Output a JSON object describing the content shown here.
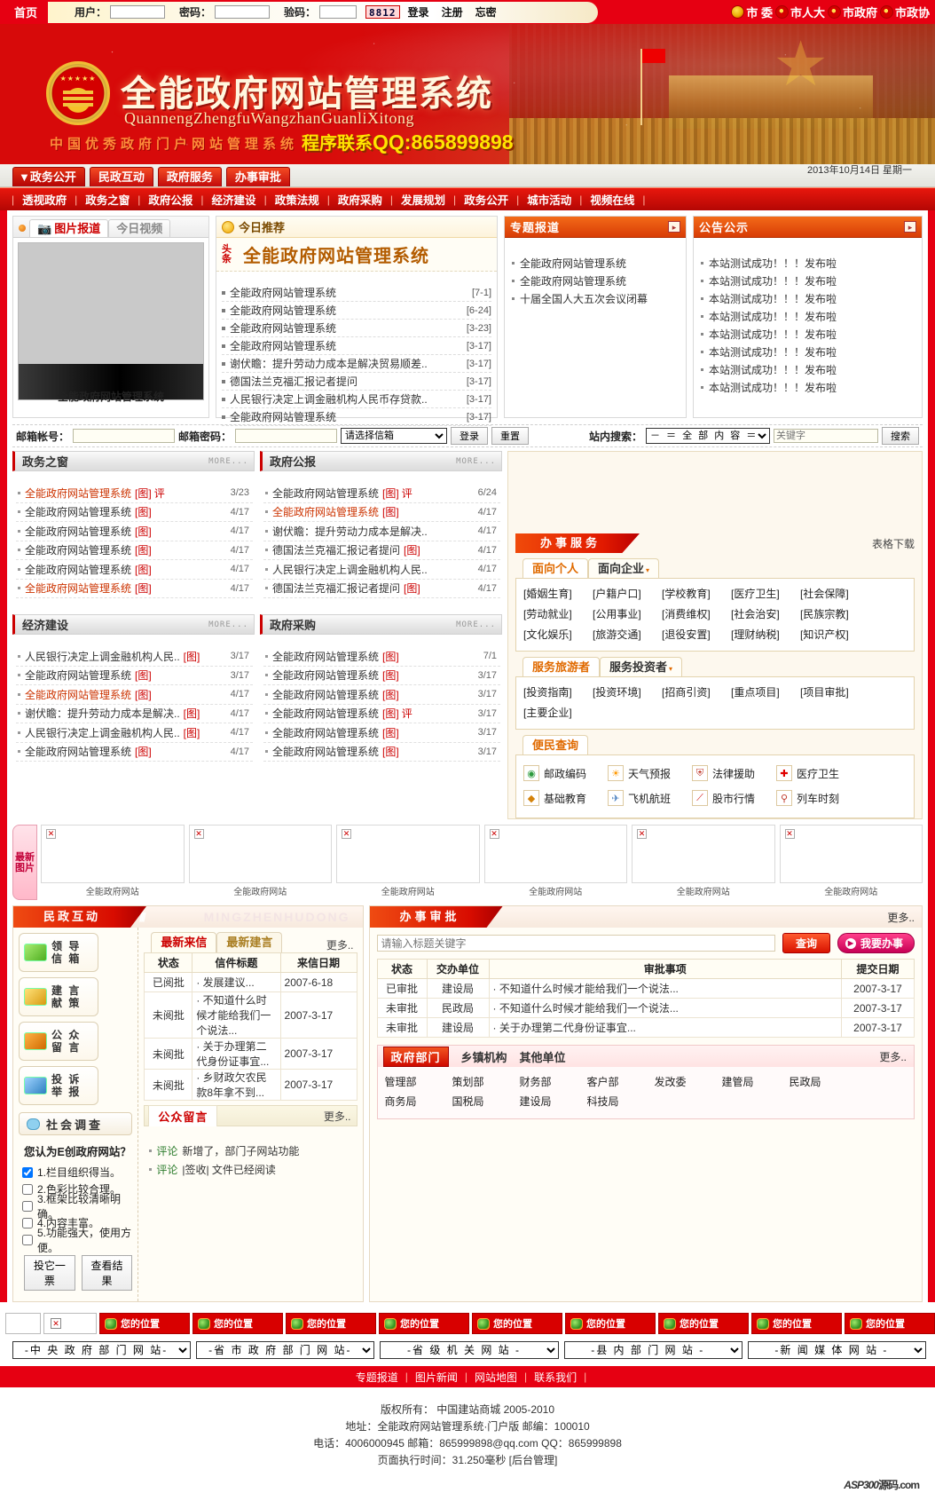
{
  "topbar": {
    "home": "首页",
    "user_label": "用户：",
    "pass_label": "密码：",
    "vcode_label": "验码：",
    "vcode_value": "8812",
    "login": "登录",
    "register": "注册",
    "forgot": "忘密",
    "gov_links": [
      "市 委",
      "市人大",
      "市政府",
      "市政协"
    ]
  },
  "banner": {
    "title_cn": "全能政府网站管理系统",
    "title_py": "QuannengZhengfuWangzhanGuanliXitong",
    "subtitle": "中国优秀政府门户网站管理系统",
    "qq_label": "程序联系",
    "qq_text": "QQ:865899898"
  },
  "mainnav": {
    "tabs": [
      "▼政务公开",
      "民政互动",
      "政府服务",
      "办事审批"
    ],
    "date": "2013年10月14日 星期一"
  },
  "subnav": {
    "items": [
      "透视政府",
      "政务之窗",
      "政府公报",
      "经济建设",
      "政策法规",
      "政府采购",
      "发展规划",
      "政务公开",
      "城市活动",
      "视频在线"
    ]
  },
  "photo_panel": {
    "tabs": [
      "图片报道",
      "今日视频"
    ],
    "caption": "全能政府网站管理系统"
  },
  "today": {
    "title": "今日推荐",
    "badge": "头条",
    "headline": "全能政府网站管理系统",
    "items": [
      {
        "title": "全能政府网站管理系统",
        "date": "[7-1]"
      },
      {
        "title": "全能政府网站管理系统",
        "date": "[6-24]"
      },
      {
        "title": "全能政府网站管理系统",
        "date": "[3-23]"
      },
      {
        "title": "全能政府网站管理系统",
        "date": "[3-17]"
      },
      {
        "title": "谢伏瞻：提升劳动力成本是解决贸易顺差..",
        "date": "[3-17]"
      },
      {
        "title": "德国法兰克福汇报记者提问",
        "date": "[3-17]"
      },
      {
        "title": "人民银行决定上调金融机构人民币存贷款..",
        "date": "[3-17]"
      },
      {
        "title": "全能政府网站管理系统",
        "date": "[3-17]"
      }
    ]
  },
  "special_report": {
    "title": "专题报道",
    "items": [
      "全能政府网站管理系统",
      "全能政府网站管理系统",
      "十届全国人大五次会议闭幕"
    ]
  },
  "notice": {
    "title": "公告公示",
    "items": [
      "本站测试成功！！！发布啦",
      "本站测试成功！！！发布啦",
      "本站测试成功！！！发布啦",
      "本站测试成功！！！发布啦",
      "本站测试成功！！！发布啦",
      "本站测试成功！！！发布啦",
      "本站测试成功！！！发布啦",
      "本站测试成功！！！发布啦"
    ]
  },
  "mailbar": {
    "account_label": "邮箱帐号：",
    "password_label": "邮箱密码：",
    "select_value": "请选择信箱",
    "login": "登录",
    "reset": "重置",
    "site_search_label": "站内搜索：",
    "scope_value": "－ ＝ 全 部 内 容 ＝ －",
    "keyword_placeholder": "关键字",
    "search": "搜索"
  },
  "sections": [
    {
      "title": "政务之窗",
      "more": "MORE...",
      "items": [
        {
          "t": "全能政府网站管理系统",
          "img": "[图]",
          "pl": "评",
          "d": "3/23",
          "red": true
        },
        {
          "t": "全能政府网站管理系统",
          "img": "[图]",
          "pl": "",
          "d": "4/17",
          "red": false
        },
        {
          "t": "全能政府网站管理系统",
          "img": "[图]",
          "pl": "",
          "d": "4/17",
          "red": false
        },
        {
          "t": "全能政府网站管理系统",
          "img": "[图]",
          "pl": "",
          "d": "4/17",
          "red": false
        },
        {
          "t": "全能政府网站管理系统",
          "img": "[图]",
          "pl": "",
          "d": "4/17",
          "red": false
        },
        {
          "t": "全能政府网站管理系统",
          "img": "[图]",
          "pl": "",
          "d": "4/17",
          "red": true
        }
      ]
    },
    {
      "title": "政府公报",
      "more": "MORE...",
      "items": [
        {
          "t": "全能政府网站管理系统",
          "img": "[图]",
          "pl": "评",
          "d": "6/24",
          "red": false
        },
        {
          "t": "全能政府网站管理系统",
          "img": "[图]",
          "pl": "",
          "d": "4/17",
          "red": true
        },
        {
          "t": "谢伏瞻：提升劳动力成本是解决..",
          "img": "",
          "pl": "",
          "d": "4/17",
          "red": false
        },
        {
          "t": "德国法兰克福汇报记者提问",
          "img": "[图]",
          "pl": "",
          "d": "4/17",
          "red": false
        },
        {
          "t": "人民银行决定上调金融机构人民..",
          "img": "",
          "pl": "",
          "d": "4/17",
          "red": false
        },
        {
          "t": "德国法兰克福汇报记者提问",
          "img": "[图]",
          "pl": "",
          "d": "4/17",
          "red": false
        }
      ]
    },
    {
      "title": "经济建设",
      "more": "MORE...",
      "items": [
        {
          "t": "人民银行决定上调金融机构人民..",
          "img": "[图]",
          "pl": "",
          "d": "3/17",
          "red": false
        },
        {
          "t": "全能政府网站管理系统",
          "img": "[图]",
          "pl": "",
          "d": "3/17",
          "red": false
        },
        {
          "t": "全能政府网站管理系统",
          "img": "[图]",
          "pl": "",
          "d": "4/17",
          "red": true
        },
        {
          "t": "谢伏瞻：提升劳动力成本是解决..",
          "img": "[图]",
          "pl": "",
          "d": "4/17",
          "red": false
        },
        {
          "t": "人民银行决定上调金融机构人民..",
          "img": "[图]",
          "pl": "",
          "d": "4/17",
          "red": false
        },
        {
          "t": "全能政府网站管理系统",
          "img": "[图]",
          "pl": "",
          "d": "4/17",
          "red": false
        }
      ]
    },
    {
      "title": "政府采购",
      "more": "MORE...",
      "items": [
        {
          "t": "全能政府网站管理系统",
          "img": "[图]",
          "pl": "",
          "d": "7/1",
          "red": false
        },
        {
          "t": "全能政府网站管理系统",
          "img": "[图]",
          "pl": "",
          "d": "3/17",
          "red": false
        },
        {
          "t": "全能政府网站管理系统",
          "img": "[图]",
          "pl": "",
          "d": "3/17",
          "red": false
        },
        {
          "t": "全能政府网站管理系统",
          "img": "[图]",
          "pl": "评",
          "d": "3/17",
          "red": false
        },
        {
          "t": "全能政府网站管理系统",
          "img": "[图]",
          "pl": "",
          "d": "3/17",
          "red": false
        },
        {
          "t": "全能政府网站管理系统",
          "img": "[图]",
          "pl": "",
          "d": "3/17",
          "red": false
        }
      ]
    }
  ],
  "services": {
    "title": "办事服务",
    "download": "表格下载",
    "tabs1": [
      "面向个人",
      "面向企业"
    ],
    "tags1": [
      "[婚姻生育]",
      "[户籍户口]",
      "[学校教育]",
      "[医疗卫生]",
      "[社会保障]",
      "[劳动就业]",
      "[公用事业]",
      "[消费维权]",
      "[社会治安]",
      "[民族宗教]",
      "[文化娱乐]",
      "[旅游交通]",
      "[退役安置]",
      "[理财纳税]",
      "[知识产权]"
    ],
    "tabs2": [
      "服务旅游者",
      "服务投资者"
    ],
    "tags2": [
      "[投资指南]",
      "[投资环境]",
      "[招商引资]",
      "[重点项目]",
      "[项目审批]",
      "[主要企业]"
    ],
    "tab3": "便民查询",
    "quick": [
      {
        "label": "邮政编码",
        "icon": "postcode-icon",
        "glyph": "◉",
        "color": "#2e9b3e"
      },
      {
        "label": "天气预报",
        "icon": "weather-icon",
        "glyph": "☀",
        "color": "#ff9800"
      },
      {
        "label": "法律援助",
        "icon": "law-icon",
        "glyph": "⛨",
        "color": "#c0392b"
      },
      {
        "label": "医疗卫生",
        "icon": "medical-icon",
        "glyph": "✚",
        "color": "#e00000"
      },
      {
        "label": "基础教育",
        "icon": "education-icon",
        "glyph": "◆",
        "color": "#d4820a"
      },
      {
        "label": "飞机航班",
        "icon": "flight-icon",
        "glyph": "✈",
        "color": "#4a80c0"
      },
      {
        "label": "股市行情",
        "icon": "stock-icon",
        "glyph": "📈",
        "color": "#d01010"
      },
      {
        "label": "列车时刻",
        "icon": "train-icon",
        "glyph": "⚲",
        "color": "#c0392b"
      }
    ]
  },
  "photostrip": {
    "label": "最新图片",
    "items": [
      {
        "caption": "全能政府网站"
      },
      {
        "caption": "全能政府网站"
      },
      {
        "caption": "全能政府网站"
      },
      {
        "caption": "全能政府网站"
      },
      {
        "caption": "全能政府网站"
      },
      {
        "caption": "全能政府网站"
      }
    ]
  },
  "interaction": {
    "title": "民政互动",
    "ghost": "MINGZHENHUDONG",
    "buttons": [
      {
        "l1": "领 导",
        "l2": "信 箱",
        "icon": "mail-green-icon",
        "c1": "#a8ec72",
        "c2": "#4fae20"
      },
      {
        "l1": "建 言",
        "l2": "献 策",
        "icon": "mail-yellow-icon",
        "c1": "#ffe27a",
        "c2": "#d89a10"
      },
      {
        "l1": "公 众",
        "l2": "留 言",
        "icon": "book-icon",
        "c1": "#ffb347",
        "c2": "#cf6a00"
      },
      {
        "l1": "投 诉",
        "l2": "举 报",
        "icon": "report-icon",
        "c1": "#9fd3ff",
        "c2": "#2d7fc0"
      }
    ],
    "survey_title": "社会调查",
    "survey_question": "您认为E创政府网站？",
    "options": [
      {
        "text": "1.栏目组织得当。",
        "checked": true
      },
      {
        "text": "2.色彩比较合理。",
        "checked": false
      },
      {
        "text": "3.框架比较清晰明确。",
        "checked": false
      },
      {
        "text": "4.内容丰富。",
        "checked": false
      },
      {
        "text": "5.功能强大，使用方便。",
        "checked": false
      }
    ],
    "vote_button": "投它一票",
    "result_button": "查看结果",
    "tabs": [
      "最新来信",
      "最新建言"
    ],
    "more": "更多..",
    "table_headers": [
      "状态",
      "信件标题",
      "来信日期"
    ],
    "rows": [
      {
        "status": "已阅批",
        "title": "发展建议...",
        "date": "2007-6-18",
        "unread": false
      },
      {
        "status": "未阅批",
        "title": "不知道什么时候才能给我们一个说法...",
        "date": "2007-3-17",
        "unread": true
      },
      {
        "status": "未阅批",
        "title": "关于办理第二代身份证事宜...",
        "date": "2007-3-17",
        "unread": true
      },
      {
        "status": "未阅批",
        "title": "乡财政欠农民款8年拿不到...",
        "date": "2007-3-17",
        "unread": true
      }
    ],
    "guestbook_title": "公众留言",
    "guestbook_more": "更多..",
    "guestbook": [
      {
        "tag": "评论",
        "text": "新增了，部门子网站功能"
      },
      {
        "tag": "评论",
        "text": "|签收| 文件已经阅读"
      }
    ]
  },
  "approval": {
    "title": "办事审批",
    "more": "更多..",
    "search_placeholder": "请输入标题关键字",
    "query_button": "查询",
    "doit_button": "我要办事",
    "table_headers": [
      "状态",
      "交办单位",
      "审批事项",
      "提交日期"
    ],
    "rows": [
      {
        "status": "已审批",
        "unit": "建设局",
        "item": "不知道什么时候才能给我们一个说法...",
        "date": "2007-3-17",
        "unread": false
      },
      {
        "status": "未审批",
        "unit": "民政局",
        "item": "不知道什么时候才能给我们一个说法...",
        "date": "2007-3-17",
        "unread": true
      },
      {
        "status": "未审批",
        "unit": "建设局",
        "item": "关于办理第二代身份证事宜...",
        "date": "2007-3-17",
        "unread": true
      }
    ],
    "dept_tabs": [
      "政府部门",
      "乡镇机构",
      "其他单位"
    ],
    "dept_more": "更多..",
    "departments": [
      "管理部",
      "策划部",
      "财务部",
      "客户部",
      "发改委",
      "建管局",
      "民政局",
      "商务局",
      "国税局",
      "建设局",
      "科技局"
    ]
  },
  "links": {
    "buttons": [
      "您的位置",
      "您的位置",
      "您的位置",
      "您的位置",
      "您的位置",
      "您的位置",
      "您的位置",
      "您的位置",
      "您的位置"
    ],
    "selects": [
      "-中 央 政 府 部 门 网 站-",
      "-省 市 政 府 部 门 网 站-",
      "-省 级 机 关 网 站 -",
      "-县 内 部 门 网 站 -",
      "-新 闻 媒 体 网 站 -"
    ]
  },
  "footer": {
    "links": [
      "专题报道",
      "图片新闻",
      "网站地图",
      "联系我们"
    ],
    "line1": "版权所有： 中国建站商城 2005-2010",
    "line2": "地址：全能政府网站管理系统·门户版 邮编：100010",
    "line3": "电话：4006000945 邮箱：865999898@qq.com QQ：865999898",
    "line4": "页面执行时间：31.250毫秒 [后台管理]",
    "logo": "ASP300",
    "logo_sm": "源码.com"
  }
}
